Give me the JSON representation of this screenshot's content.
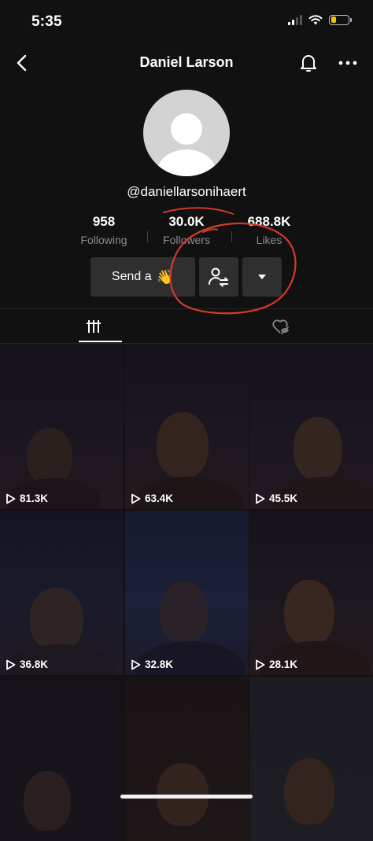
{
  "status": {
    "time": "5:35",
    "battery_level": 0.28
  },
  "header": {
    "title": "Daniel Larson"
  },
  "profile": {
    "username": "@daniellarsonihaert"
  },
  "stats": [
    {
      "value": "958",
      "label": "Following"
    },
    {
      "value": "30.0K",
      "label": "Followers"
    },
    {
      "value": "688.8K",
      "label": "Likes"
    }
  ],
  "actions": {
    "send_label": "Send a",
    "send_emoji": "👋"
  },
  "videos": [
    {
      "views": "81.3K"
    },
    {
      "views": "63.4K"
    },
    {
      "views": "45.5K"
    },
    {
      "views": "36.8K"
    },
    {
      "views": "32.8K"
    },
    {
      "views": "28.1K"
    },
    {
      "views": ""
    },
    {
      "views": ""
    },
    {
      "views": ""
    }
  ],
  "colors": {
    "annotation": "#d23a2a",
    "battery": "#f5c400",
    "background": "#111111"
  },
  "icons": [
    "back-arrow",
    "bell",
    "more-dots",
    "friend-follow",
    "caret-down",
    "grid-videos",
    "liked-hidden",
    "play"
  ]
}
